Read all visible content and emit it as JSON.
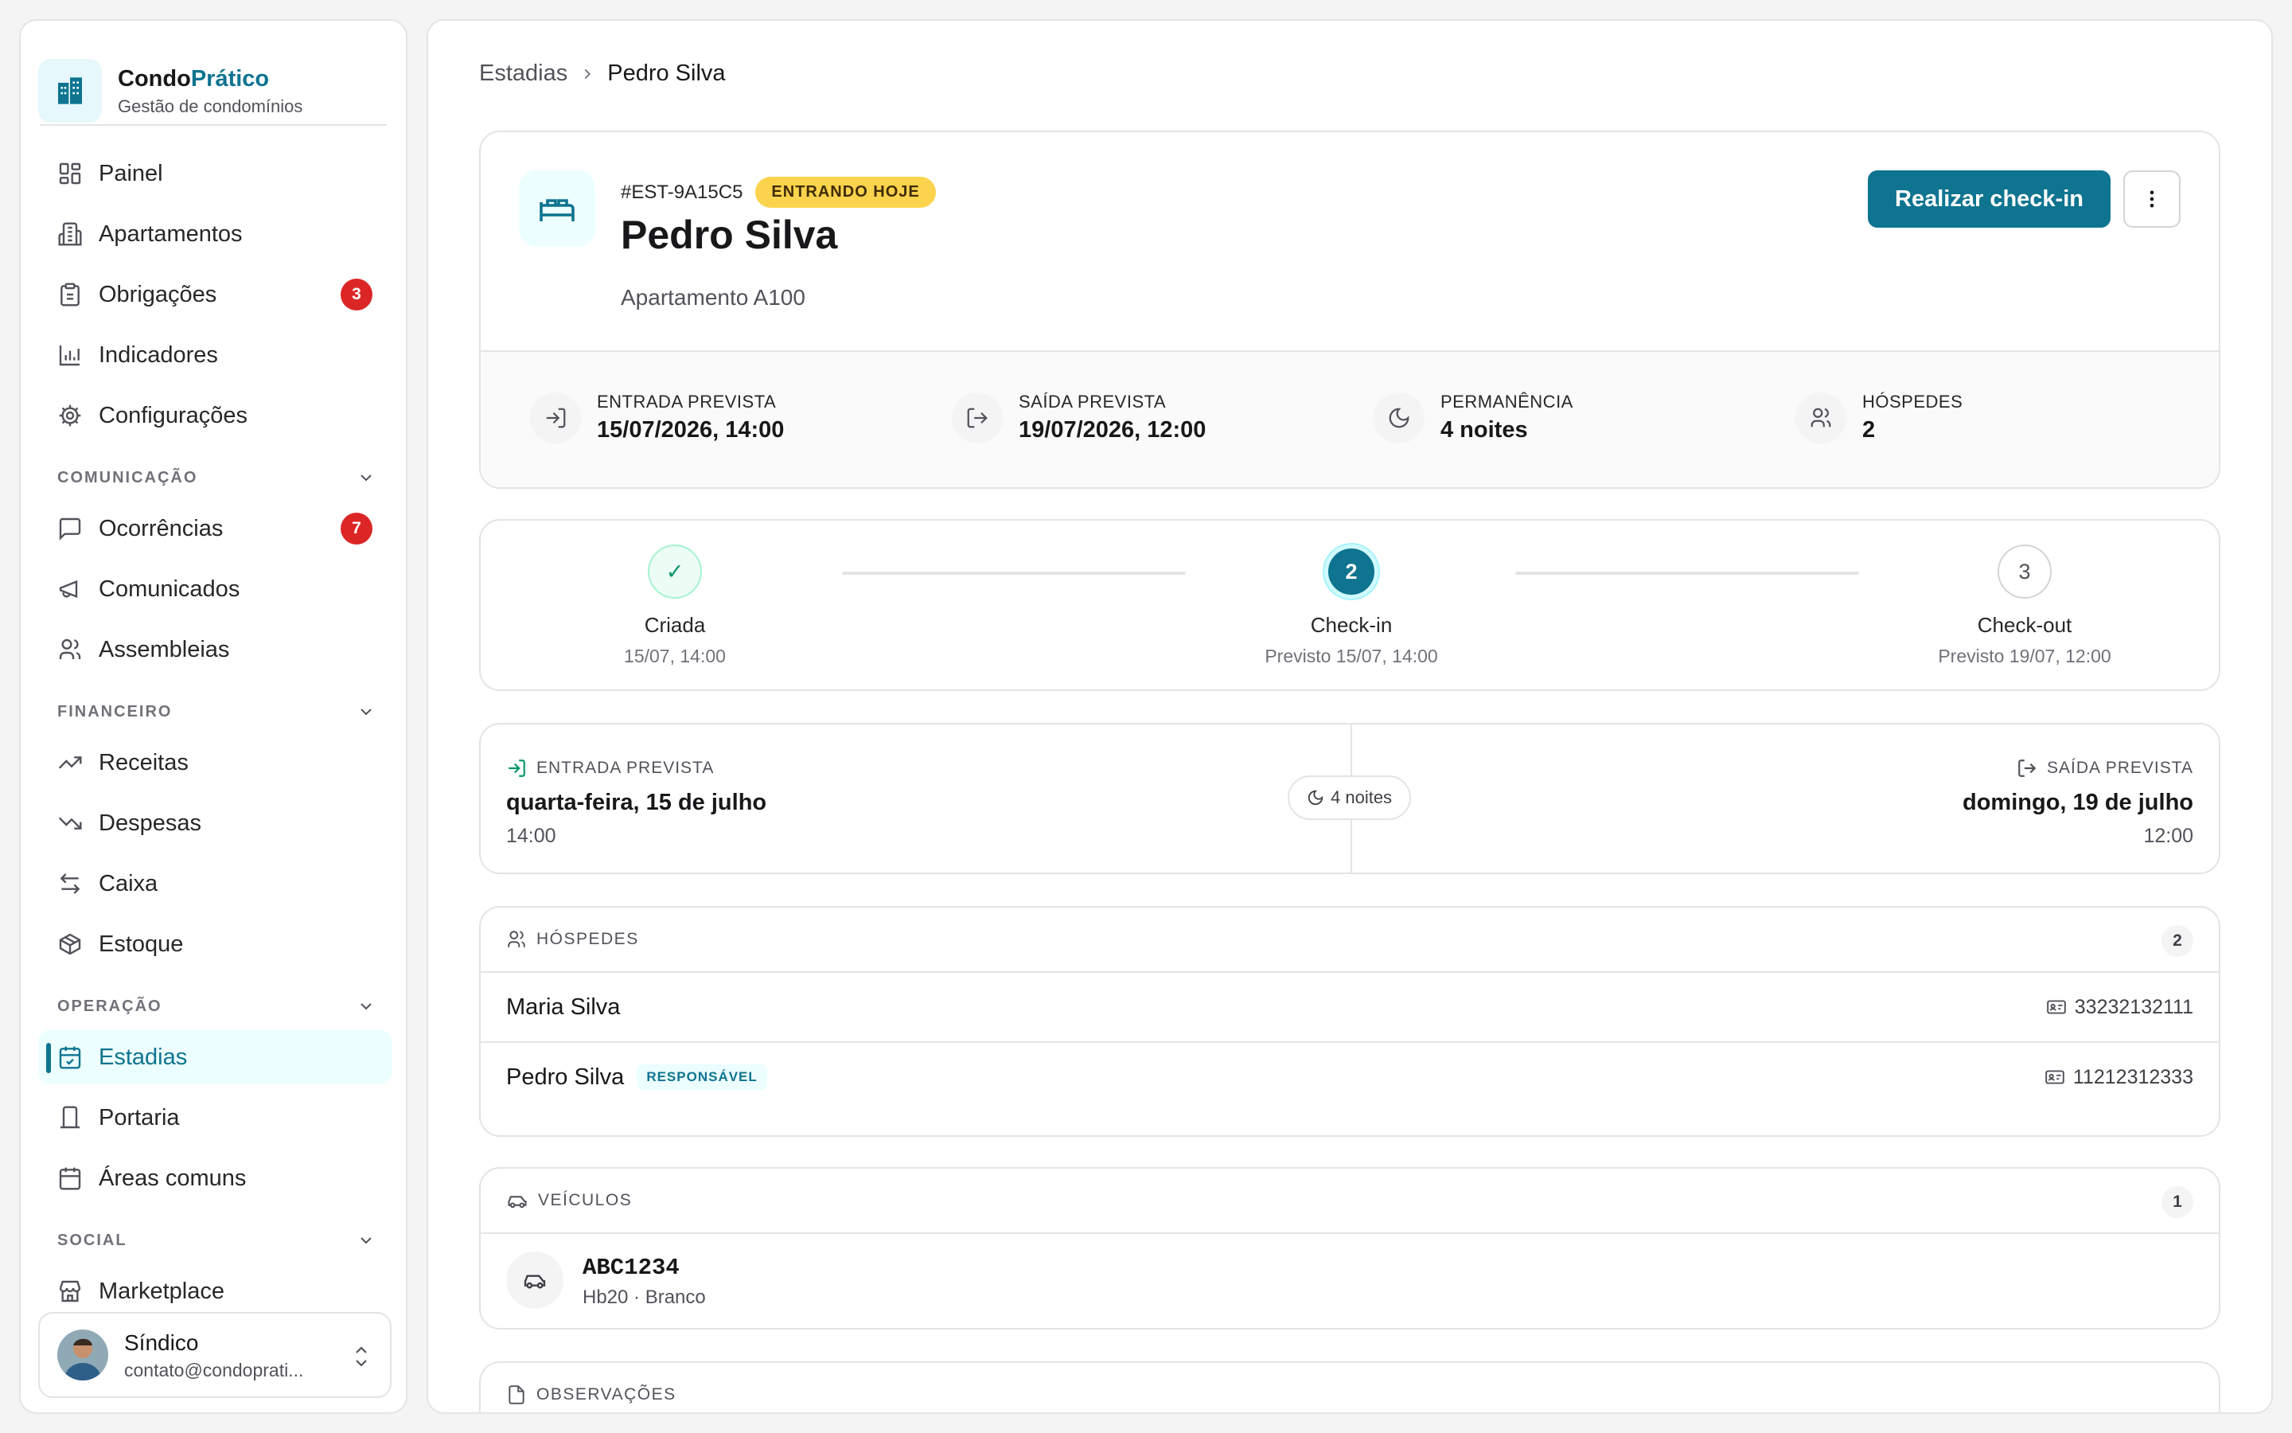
{
  "brand": {
    "name_part1": "Condo",
    "name_part2": "Prático",
    "subtitle": "Gestão de condomínios"
  },
  "sidebar": {
    "main_items": [
      {
        "label": "Painel",
        "icon": "grid-icon"
      },
      {
        "label": "Apartamentos",
        "icon": "building-icon"
      },
      {
        "label": "Obrigações",
        "icon": "clipboard-icon",
        "badge": "3"
      },
      {
        "label": "Indicadores",
        "icon": "bar-chart-icon"
      },
      {
        "label": "Configurações",
        "icon": "gear-icon"
      }
    ],
    "sections": [
      {
        "title": "COMUNICAÇÃO",
        "items": [
          {
            "label": "Ocorrências",
            "icon": "message-square-icon",
            "badge": "7"
          },
          {
            "label": "Comunicados",
            "icon": "megaphone-icon"
          },
          {
            "label": "Assembleias",
            "icon": "users-icon"
          }
        ]
      },
      {
        "title": "FINANCEIRO",
        "items": [
          {
            "label": "Receitas",
            "icon": "trending-up-icon"
          },
          {
            "label": "Despesas",
            "icon": "trending-down-icon"
          },
          {
            "label": "Caixa",
            "icon": "arrows-left-right-icon"
          },
          {
            "label": "Estoque",
            "icon": "package-icon"
          }
        ]
      },
      {
        "title": "OPERAÇÃO",
        "items": [
          {
            "label": "Estadias",
            "icon": "calendar-check-icon",
            "active": true
          },
          {
            "label": "Portaria",
            "icon": "door-icon"
          },
          {
            "label": "Áreas comuns",
            "icon": "calendar-icon"
          }
        ]
      },
      {
        "title": "SOCIAL",
        "items": [
          {
            "label": "Marketplace",
            "icon": "store-icon"
          }
        ]
      }
    ],
    "user": {
      "name": "Síndico",
      "email": "contato@condoprati..."
    }
  },
  "breadcrumb": {
    "parent": "Estadias",
    "current": "Pedro Silva"
  },
  "stay": {
    "code": "#EST-9A15C5",
    "status": "ENTRANDO HOJE",
    "guest_name": "Pedro Silva",
    "apartment": "Apartamento A100",
    "checkin_button": "Realizar check-in",
    "stats": [
      {
        "label": "ENTRADA PREVISTA",
        "value": "15/07/2026, 14:00",
        "icon": "log-in-icon"
      },
      {
        "label": "SAÍDA PREVISTA",
        "value": "19/07/2026, 12:00",
        "icon": "log-out-icon"
      },
      {
        "label": "PERMANÊNCIA",
        "value": "4 noites",
        "icon": "moon-icon"
      },
      {
        "label": "HÓSPEDES",
        "value": "2",
        "icon": "users-icon"
      }
    ]
  },
  "steps": [
    {
      "marker": "✓",
      "title": "Criada",
      "date": "15/07, 14:00",
      "state": "done"
    },
    {
      "marker": "2",
      "title": "Check-in",
      "date": "Previsto 15/07, 14:00",
      "state": "current"
    },
    {
      "marker": "3",
      "title": "Check-out",
      "date": "Previsto 19/07, 12:00",
      "state": "todo"
    }
  ],
  "dates": {
    "entry_label": "ENTRADA PREVISTA",
    "entry_date": "quarta-feira, 15 de julho",
    "entry_time": "14:00",
    "nights": "4 noites",
    "exit_label": "SAÍDA PREVISTA",
    "exit_date": "domingo, 19 de julho",
    "exit_time": "12:00"
  },
  "guests": {
    "title": "HÓSPEDES",
    "count": "2",
    "rows": [
      {
        "name": "Maria Silva",
        "doc": "33232132111",
        "tag": ""
      },
      {
        "name": "Pedro Silva",
        "doc": "11212312333",
        "tag": "RESPONSÁVEL"
      }
    ]
  },
  "vehicles": {
    "title": "VEÍCULOS",
    "count": "1",
    "rows": [
      {
        "plate": "ABC1234",
        "desc": "Hb20 · Branco"
      }
    ]
  },
  "notes": {
    "title": "OBSERVAÇÕES"
  },
  "colors": {
    "accent": "#0e7490",
    "badge": "#dc2626",
    "status_yellow": "#fcd34d",
    "done_green": "#059669"
  }
}
